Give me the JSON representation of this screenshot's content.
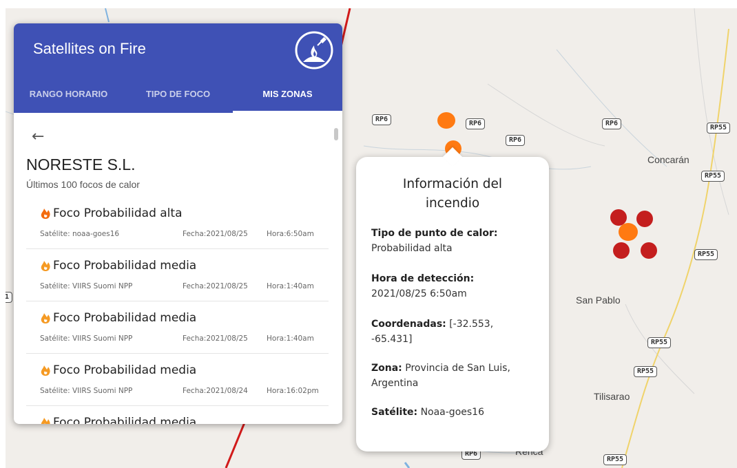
{
  "app": {
    "title": "Satellites on Fire",
    "logo_icon": "satellite-fire-logo-icon"
  },
  "tabs": [
    {
      "label": "RANGO HORARIO",
      "active": false
    },
    {
      "label": "TIPO DE FOCO",
      "active": false
    },
    {
      "label": "MIS ZONAS",
      "active": true
    }
  ],
  "zone": {
    "name": "NORESTE S.L.",
    "subtitle": "Últimos 100 focos de calor"
  },
  "focus_list": [
    {
      "title": "Foco Probabilidad alta",
      "satellite": "Satélite: noaa-goes16",
      "date": "Fecha:2021/08/25",
      "hour": "Hora:6:50am"
    },
    {
      "title": "Foco Probabilidad media",
      "satellite": "Satélite: VIIRS Suomi NPP",
      "date": "Fecha:2021/08/25",
      "hour": "Hora:1:40am"
    },
    {
      "title": "Foco Probabilidad media",
      "satellite": "Satélite: VIIRS Suomi NPP",
      "date": "Fecha:2021/08/25",
      "hour": "Hora:1:40am"
    },
    {
      "title": "Foco Probabilidad media",
      "satellite": "Satélite: VIIRS Suomi NPP",
      "date": "Fecha:2021/08/24",
      "hour": "Hora:16:02pm"
    },
    {
      "title": "Foco Probabilidad media",
      "satellite": "",
      "date": "",
      "hour": ""
    }
  ],
  "popup": {
    "title": "Información del incendio",
    "fields": [
      {
        "label": "Tipo de punto de calor:",
        "value": "Probabilidad alta"
      },
      {
        "label": "Hora de detección:",
        "value": "2021/08/25 6:50am"
      },
      {
        "label": "Coordenadas:",
        "value": "[-32.553, -65.431]"
      },
      {
        "label": "Zona:",
        "value": "Provincia de San Luis, Argentina"
      },
      {
        "label": "Satélite:",
        "value": "Noaa-goes16"
      }
    ]
  },
  "map": {
    "road_shields": [
      "RP6",
      "RP6",
      "RP6",
      "RP6",
      "RP55",
      "RP55",
      "RP55",
      "RP55",
      "RP55",
      "RP6",
      "RP55",
      "1"
    ],
    "towns": [
      "Concarán",
      "San Pablo",
      "Tilisarao",
      "Renca"
    ],
    "colors": {
      "fire_high": "#c41e1e",
      "fire_medium": "#ff7a12",
      "header": "#3f51b5"
    }
  }
}
